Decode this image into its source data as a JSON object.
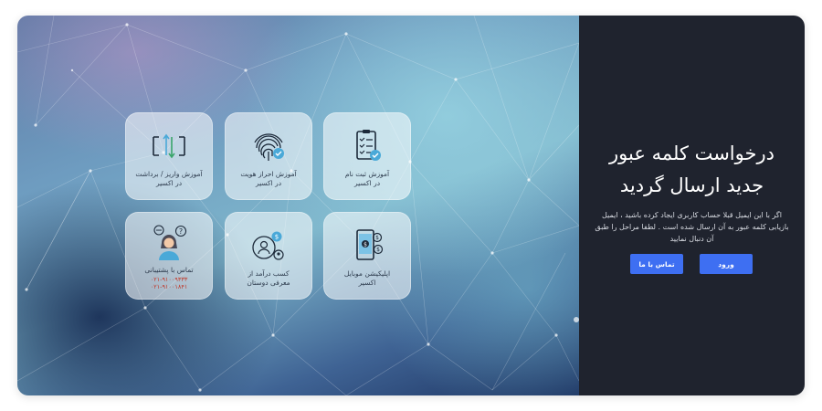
{
  "panel": {
    "title_line1": "درخواست کلمه عبور",
    "title_line2": "جدید ارسال گردید",
    "description": "اگر با این ایمیل قبلا حساب کاربری ایجاد کرده باشید ، ایمیل بازیابی کلمه عبور به آن ارسال شده است . لطفا مراحل را طبق آن دنبال نمایید",
    "login_label": "ورود",
    "contact_label": "تماس با ما",
    "button_color": "#3e6ff2",
    "background_color": "#1f232e"
  },
  "tiles": [
    {
      "id": "register",
      "icon": "checklist-icon",
      "label": "آموزش ثبت نام\nدر اکسیر"
    },
    {
      "id": "kyc",
      "icon": "fingerprint-icon",
      "label": "آموزش احراز هویت\nدر اکسیر"
    },
    {
      "id": "deposit",
      "icon": "wallet-transfer-icon",
      "label": "آموزش واریز / برداشت\nدر اکسیر"
    },
    {
      "id": "app",
      "icon": "mobile-payment-icon",
      "label": "اپلیکیشن موبایل\nاکسیر"
    },
    {
      "id": "referral",
      "icon": "referral-users-icon",
      "label": "کسب درآمد از\nمعرفی دوستان"
    },
    {
      "id": "support",
      "icon": "support-agent-icon",
      "label": "تماس با پشتیبانی",
      "phone": "۰۲۱-۹۱۰۰۹۳۳۳\n۰۲۱-۹۱۰۰۱۸۴۱"
    }
  ]
}
